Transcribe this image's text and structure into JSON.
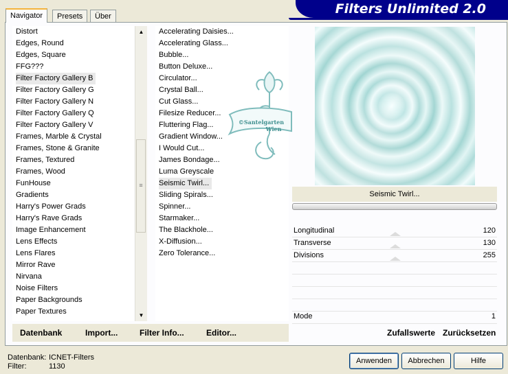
{
  "tabs": [
    "Navigator",
    "Presets",
    "Über"
  ],
  "title": "Filters Unlimited 2.0",
  "categories": [
    "Distort",
    "Edges, Round",
    "Edges, Square",
    "FFG???",
    "Filter Factory Gallery B",
    "Filter Factory Gallery G",
    "Filter Factory Gallery N",
    "Filter Factory Gallery Q",
    "Filter Factory Gallery V",
    "Frames, Marble & Crystal",
    "Frames, Stone & Granite",
    "Frames, Textured",
    "Frames, Wood",
    "FunHouse",
    "Gradients",
    "Harry's Power Grads",
    "Harry's Rave Grads",
    "Image Enhancement",
    "Lens Effects",
    "Lens Flares",
    "Mirror Rave",
    "Nirvana",
    "Noise Filters",
    "Paper Backgrounds",
    "Paper Textures"
  ],
  "selected_category": "Filter Factory Gallery B",
  "filters": [
    "Accelerating Daisies...",
    "Accelerating Glass...",
    "Bubble...",
    "Button Deluxe...",
    "Circulator...",
    "Crystal Ball...",
    "Cut Glass...",
    "Filesize Reducer...",
    "Fluttering Flag...",
    "Gradient Window...",
    "I Would Cut...",
    "James Bondage...",
    "Luma Greyscale",
    "Seismic Twirl...",
    "Sliding Spirals...",
    "Spinner...",
    "Starmaker...",
    "The Blackhole...",
    "X-Diffusion...",
    "Zero Tolerance..."
  ],
  "selected_filter": "Seismic Twirl...",
  "watermark": {
    "line1": "©Santelgarten",
    "line2": "Wien"
  },
  "link_buttons": {
    "datenbank": "Datenbank",
    "import": "Import...",
    "filter_info": "Filter Info...",
    "editor": "Editor..."
  },
  "filter_name": "Seismic Twirl...",
  "params": [
    {
      "label": "Longitudinal",
      "value": "120"
    },
    {
      "label": "Transverse",
      "value": "130"
    },
    {
      "label": "Divisions",
      "value": "255"
    }
  ],
  "mode": {
    "label": "Mode",
    "value": "1"
  },
  "zufallswerte": "Zufallswerte",
  "zuruecksetzen": "Zurücksetzen",
  "status": {
    "db_label": "Datenbank:",
    "db_value": "ICNET-Filters",
    "filter_label": "Filter:",
    "filter_value": "1130"
  },
  "buttons": {
    "apply": "Anwenden",
    "cancel": "Abbrechen",
    "help": "Hilfe"
  },
  "colors": {
    "banner": "#00008b",
    "preview": "#bfe3e2",
    "tab_accent": "#f4b33b"
  }
}
